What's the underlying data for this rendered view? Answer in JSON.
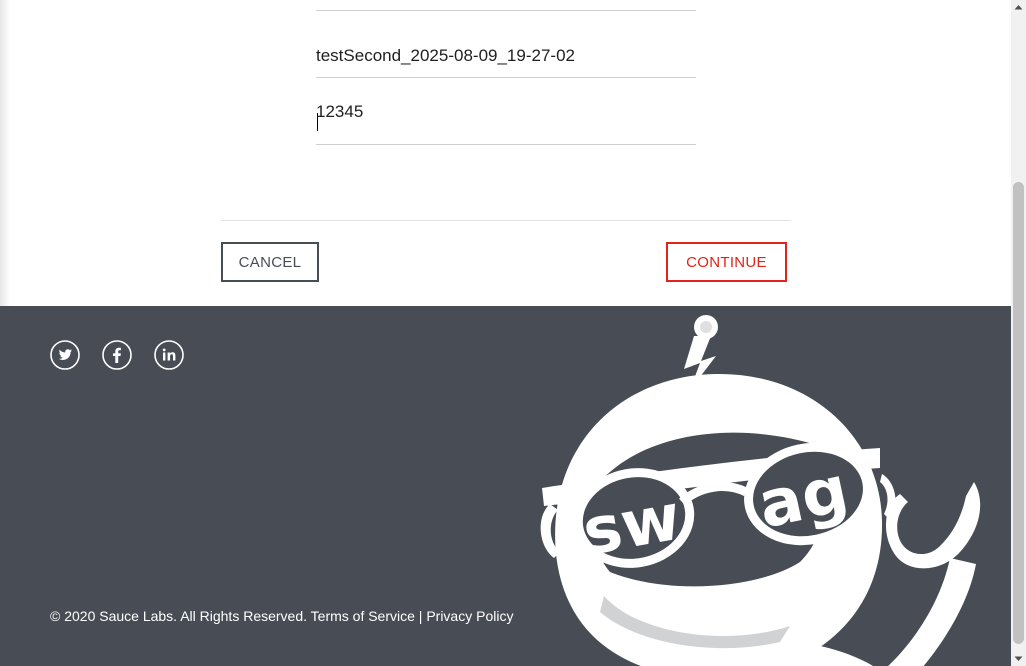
{
  "form": {
    "first_name_value": "",
    "last_name_value": "testSecond_2025-08-09_19-27-02",
    "postal_code_value": "12345"
  },
  "buttons": {
    "cancel_label": "CANCEL",
    "continue_label": "CONTINUE"
  },
  "footer": {
    "social": [
      {
        "name": "twitter-icon"
      },
      {
        "name": "facebook-icon"
      },
      {
        "name": "linkedin-icon"
      }
    ],
    "copyright": "© 2020 Sauce Labs. All Rights Reserved. Terms of Service | Privacy Policy",
    "mascot_text": "swag"
  },
  "colors": {
    "footer_bg": "#474c55",
    "accent_red": "#e2231a",
    "dark_gray": "#474c55"
  }
}
